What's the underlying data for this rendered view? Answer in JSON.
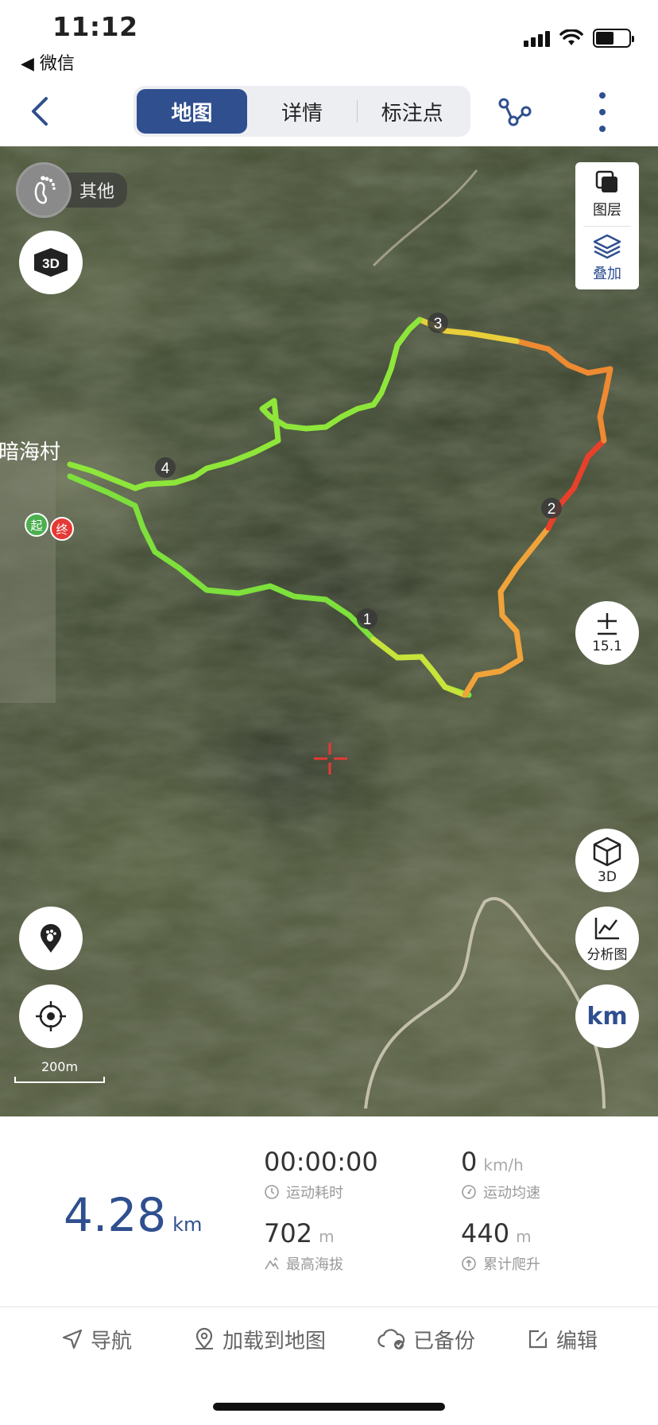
{
  "status_bar": {
    "time": "11:12",
    "back_app": "◀ 微信"
  },
  "navbar": {
    "tabs": [
      {
        "label": "地图",
        "active": true
      },
      {
        "label": "详情",
        "active": false
      },
      {
        "label": "标注点",
        "active": false
      }
    ]
  },
  "map": {
    "mode_label": "其他",
    "layer_panel": {
      "layers_label": "图层",
      "overlay_label": "叠加"
    },
    "zoom": "15.1",
    "right_buttons": {
      "view3d_label": "3D",
      "analysis_label": "分析图",
      "unit_label": "km"
    },
    "scale_label": "200m",
    "place_label": "暗海村",
    "start_label": "起",
    "end_label": "终",
    "waypoints": [
      "1",
      "2",
      "3",
      "4"
    ],
    "colors": {
      "accent": "#2f4f8f",
      "start": "#4caf50",
      "end": "#e53935"
    }
  },
  "stats": {
    "distance": "4.28",
    "distance_unit": "km",
    "duration": "00:00:00",
    "duration_label": "运动耗时",
    "speed": "0",
    "speed_unit": "km/h",
    "speed_label": "运动均速",
    "max_alt": "702",
    "max_alt_unit": "m",
    "max_alt_label": "最高海拔",
    "climb": "440",
    "climb_unit": "m",
    "climb_label": "累计爬升"
  },
  "actions": [
    {
      "label": "导航",
      "icon": "navigate-icon"
    },
    {
      "label": "加载到地图",
      "icon": "map-pin-icon"
    },
    {
      "label": "已备份",
      "icon": "cloud-check-icon"
    },
    {
      "label": "编辑",
      "icon": "edit-icon"
    }
  ]
}
